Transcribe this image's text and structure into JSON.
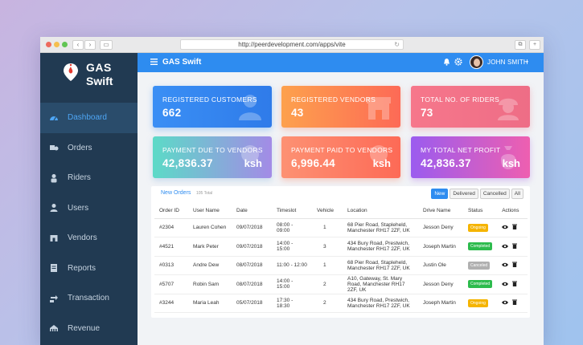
{
  "browser": {
    "url": "http://peerdevelopment.com/apps/vite"
  },
  "sidebar": {
    "logo_line1": "GAS",
    "logo_line2": "Swift",
    "items": [
      {
        "label": "Dashboard",
        "icon": "dashboard-icon"
      },
      {
        "label": "Orders",
        "icon": "orders-icon"
      },
      {
        "label": "Riders",
        "icon": "rider-icon"
      },
      {
        "label": "Users",
        "icon": "user-icon"
      },
      {
        "label": "Vendors",
        "icon": "vendor-icon"
      },
      {
        "label": "Reports",
        "icon": "reports-icon"
      },
      {
        "label": "Transaction",
        "icon": "transaction-icon"
      },
      {
        "label": "Revenue",
        "icon": "revenue-icon"
      }
    ]
  },
  "header": {
    "title": "GAS Swift",
    "user_name": "JOHN SMITH",
    "caret": "⌄"
  },
  "cards": [
    {
      "title": "Registered Customers",
      "value": "662",
      "unit": "",
      "icon": "customer-icon"
    },
    {
      "title": "Registered Vendors",
      "value": "43",
      "unit": "",
      "icon": "store-icon"
    },
    {
      "title": "Total no. of Riders",
      "value": "73",
      "unit": "",
      "icon": "rider-helmet-icon"
    },
    {
      "title": "Payment due to Vendors",
      "value": "42,836.37",
      "unit": "ksh",
      "icon": "payment-icon"
    },
    {
      "title": "Payment Paid to Vendors",
      "value": "6,996.44",
      "unit": "ksh",
      "icon": "paid-icon"
    },
    {
      "title": "My Total Net Profit",
      "value": "42,836.37",
      "unit": "ksh",
      "icon": "money-bag-icon"
    }
  ],
  "orders": {
    "title": "New Orders",
    "total": "105 Total",
    "filters": [
      "New",
      "Delivered",
      "Cancelled",
      "All"
    ],
    "active_filter": "New",
    "columns": [
      "Order ID",
      "User Name",
      "Date",
      "Timeslot",
      "Vehicle",
      "Location",
      "Drive Name",
      "Status",
      "Actions"
    ],
    "rows": [
      {
        "id": "#2304",
        "user": "Lauren Cohen",
        "date": "09/07/2018",
        "timeslot": "08:00 - 09:00",
        "vehicle": "1",
        "location": "68 Pier Road, Stapleheld, Manchester RH17 2ZF, UK",
        "driver": "Jesson Deny",
        "status": "Ongoing",
        "status_color": "#f5b400"
      },
      {
        "id": "#4521",
        "user": "Mark Peter",
        "date": "09/07/2018",
        "timeslot": "14:00 - 15:00",
        "vehicle": "3",
        "location": "434 Bury Road, Prestwich, Manchester RH17 2ZF, UK",
        "driver": "Joseph Martin",
        "status": "Completed",
        "status_color": "#2dbb4d"
      },
      {
        "id": "#0313",
        "user": "Andre Dew",
        "date": "08/07/2018",
        "timeslot": "11:00 - 12:00",
        "vehicle": "1",
        "location": "68 Pier Road, Stapleheld, Manchester RH17 2ZF, UK",
        "driver": "Justin Ole",
        "status": "Canceled",
        "status_color": "#b0b0b0"
      },
      {
        "id": "#5707",
        "user": "Robin Sam",
        "date": "08/07/2018",
        "timeslot": "14:00 - 15:00",
        "vehicle": "2",
        "location": "A10, Gateway, St. Mary Road, Manchester RH17 2ZF, UK",
        "driver": "Jesson Deny",
        "status": "Completed",
        "status_color": "#2dbb4d"
      },
      {
        "id": "#3244",
        "user": "Maria Leah",
        "date": "05/07/2018",
        "timeslot": "17:30 - 18:30",
        "vehicle": "2",
        "location": "434 Bury Road, Prestwich, Manchester RH17 2ZF, UK",
        "driver": "Joseph Martin",
        "status": "Ongoing",
        "status_color": "#f5b400"
      }
    ]
  },
  "colors": {
    "primary": "#2e8cf0",
    "sidebar": "#213a52",
    "card1": "#3a8ff5",
    "card2": "#fd7b42",
    "card3": "#f06f86",
    "card4": "#5bd6cb",
    "card5": "#fd7b62",
    "card6": "#a560ef"
  }
}
